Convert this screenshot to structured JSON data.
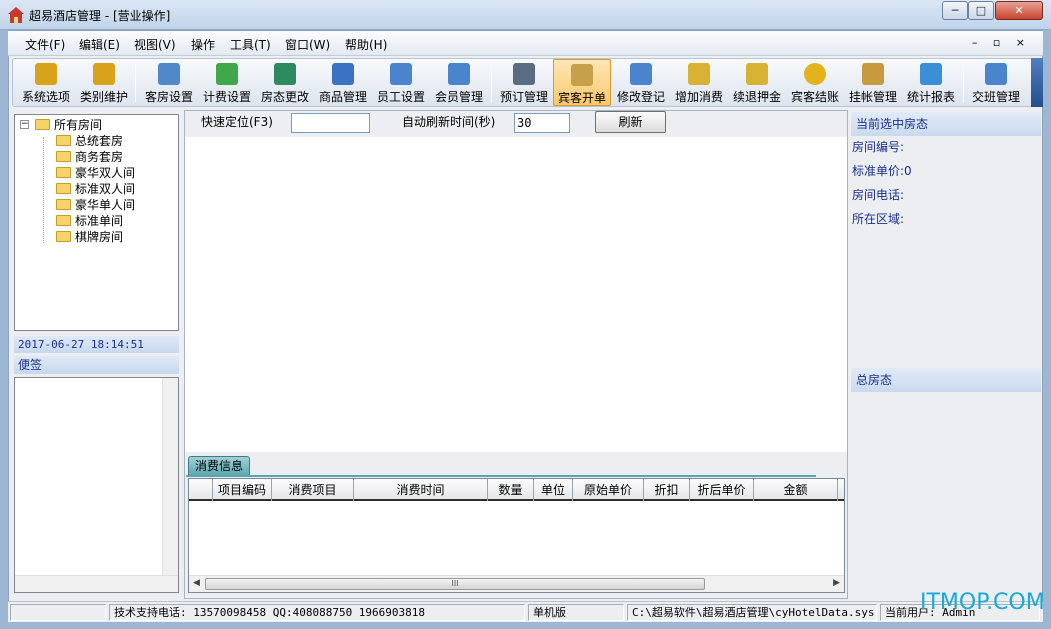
{
  "window": {
    "title": "超易酒店管理 - [营业操作]",
    "minimize_glyph": "─",
    "maximize_glyph": "□",
    "close_glyph": "✕"
  },
  "menu": {
    "items": [
      "文件(F)",
      "编辑(E)",
      "视图(V)",
      "操作",
      "工具(T)",
      "窗口(W)",
      "帮助(H)"
    ],
    "mdi_controls": "– ▫ ×"
  },
  "toolbar": {
    "buttons": [
      {
        "label": "系统选项",
        "icon": "key-icon",
        "color": "#d9a21b"
      },
      {
        "label": "类别维护",
        "icon": "key-icon",
        "color": "#d9a21b"
      },
      {
        "label": "客房设置",
        "icon": "building-icon",
        "color": "#4f89c9"
      },
      {
        "label": "计费设置",
        "icon": "money-icon",
        "color": "#3fa84a"
      },
      {
        "label": "房态更改",
        "icon": "room-status-icon",
        "color": "#2d8a5f"
      },
      {
        "label": "商品管理",
        "icon": "goods-icon",
        "color": "#3c72c2"
      },
      {
        "label": "员工设置",
        "icon": "staff-icon",
        "color": "#4a84cc"
      },
      {
        "label": "会员管理",
        "icon": "member-icon",
        "color": "#4a84cc"
      },
      {
        "label": "预订管理",
        "icon": "stapler-icon",
        "color": "#5a6c82"
      },
      {
        "label": "宾客开单",
        "icon": "box-icon",
        "color": "#c7a04c"
      },
      {
        "label": "修改登记",
        "icon": "edit-user-icon",
        "color": "#4a84cc"
      },
      {
        "label": "增加消费",
        "icon": "add-consume-icon",
        "color": "#d8b233"
      },
      {
        "label": "续退押金",
        "icon": "deposit-icon",
        "color": "#d8b233"
      },
      {
        "label": "宾客结账",
        "icon": "yen-coin-icon",
        "color": "#e3b31e"
      },
      {
        "label": "挂帐管理",
        "icon": "money-bag-icon",
        "color": "#c79a3d"
      },
      {
        "label": "统计报表",
        "icon": "bar-chart-icon",
        "color": "#3b8fd6"
      },
      {
        "label": "交班管理",
        "icon": "shift-icon",
        "color": "#4a84cc"
      }
    ],
    "active_label": "宾客开单"
  },
  "tree": {
    "root": "所有房间",
    "children": [
      "总统套房",
      "商务套房",
      "豪华双人间",
      "标准双人间",
      "豪华单人间",
      "标准单间",
      "棋牌房间"
    ]
  },
  "left": {
    "datetime": "2017-06-27 18:14:51",
    "memo_title": "便签"
  },
  "search": {
    "quick_locate_label": "快速定位(F3)",
    "quick_locate_value": "",
    "auto_refresh_label": "自动刷新时间(秒)",
    "auto_refresh_value": "30",
    "refresh_button": "刷新"
  },
  "consume": {
    "tab_label": "消费信息",
    "columns": [
      "",
      "项目编码",
      "消费项目",
      "消费时间",
      "数量",
      "单位",
      "原始单价",
      "折扣",
      "折后单价",
      "金额"
    ],
    "rows": [],
    "scroll_thumb_glyph": "III"
  },
  "right": {
    "selected_header": "当前选中房态",
    "fields": [
      "房间编号:",
      "标准单价:0",
      "房间电话:",
      "所在区域:"
    ],
    "total_header": "总房态"
  },
  "status": {
    "cells": [
      "",
      "技术支持电话: 13570098458 QQ:408088750 1966903818",
      "单机版",
      "C:\\超易软件\\超易酒店管理\\cyHotelData.sys",
      "当前用户: Admin"
    ]
  },
  "watermark": "ITMOP.COM"
}
